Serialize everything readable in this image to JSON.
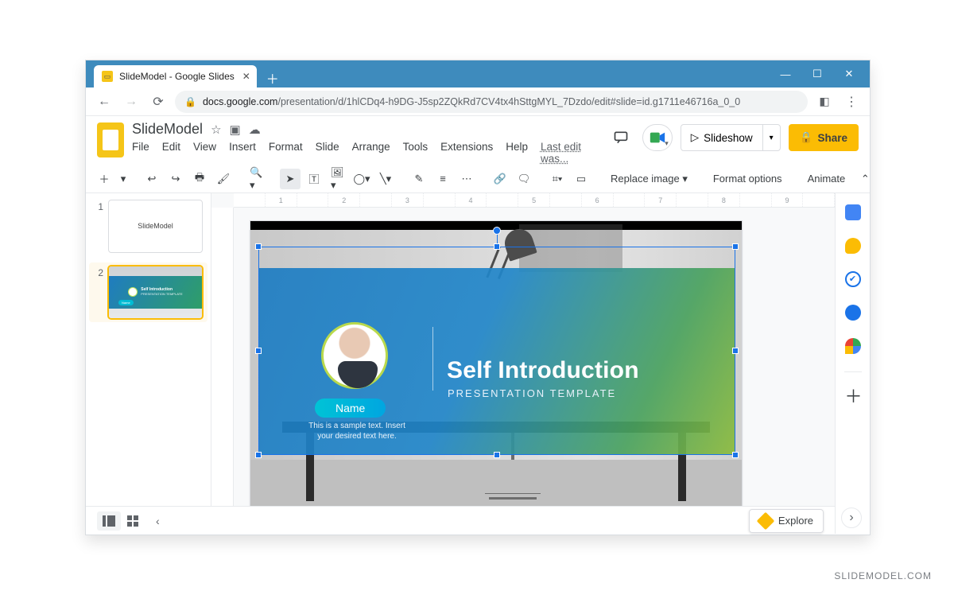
{
  "browser": {
    "tab_title": "SlideModel - Google Slides",
    "url_domain": "docs.google.com",
    "url_path": "/presentation/d/1hlCDq4-h9DG-J5sp2ZQkRd7CV4tx4hSttgMYL_7Dzdo/edit#slide=id.g1711e46716a_0_0"
  },
  "doc": {
    "title": "SlideModel",
    "menus": [
      "File",
      "Edit",
      "View",
      "Insert",
      "Format",
      "Slide",
      "Arrange",
      "Tools",
      "Extensions",
      "Help"
    ],
    "last_edit": "Last edit was...",
    "slideshow_label": "Slideshow",
    "share_label": "Share"
  },
  "toolbar": {
    "replace_image": "Replace image",
    "format_options": "Format options",
    "animate": "Animate"
  },
  "ruler_ticks": [
    "",
    "1",
    "",
    "2",
    "",
    "3",
    "",
    "4",
    "",
    "5",
    "",
    "6",
    "",
    "7",
    "",
    "8",
    "",
    "9",
    ""
  ],
  "thumbnails": {
    "slide1_text": "SlideModel",
    "slide2_title": "Self Introduction"
  },
  "slide": {
    "heading": "Self Introduction",
    "subheading": "PRESENTATION TEMPLATE",
    "name_pill": "Name",
    "sample_text": "This is a sample text. Insert your desired text here."
  },
  "explore_label": "Explore",
  "watermark": "SLIDEMODEL.COM"
}
